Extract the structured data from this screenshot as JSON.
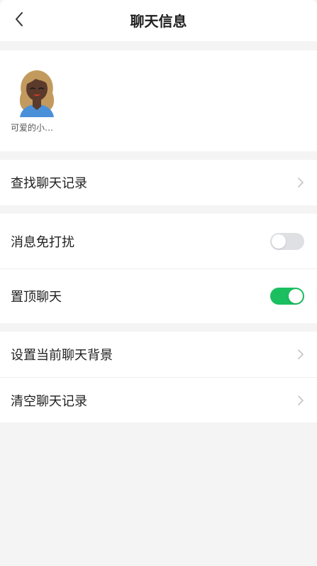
{
  "header": {
    "title": "聊天信息",
    "back_icon": "chevron-left-icon"
  },
  "members": [
    {
      "name": "可爱的小…",
      "avatar_icon": "woman-avatar-icon"
    }
  ],
  "search_section": {
    "find_history_label": "查找聊天记录"
  },
  "toggles": {
    "mute": {
      "label": "消息免打扰",
      "on": false
    },
    "pin": {
      "label": "置顶聊天",
      "on": true
    }
  },
  "settings_section": {
    "set_background_label": "设置当前聊天背景",
    "clear_history_label": "清空聊天记录"
  },
  "colors": {
    "toggle_on": "#1bbf5f",
    "toggle_off": "#dfe0e4",
    "page_background": "#f4f4f4"
  }
}
